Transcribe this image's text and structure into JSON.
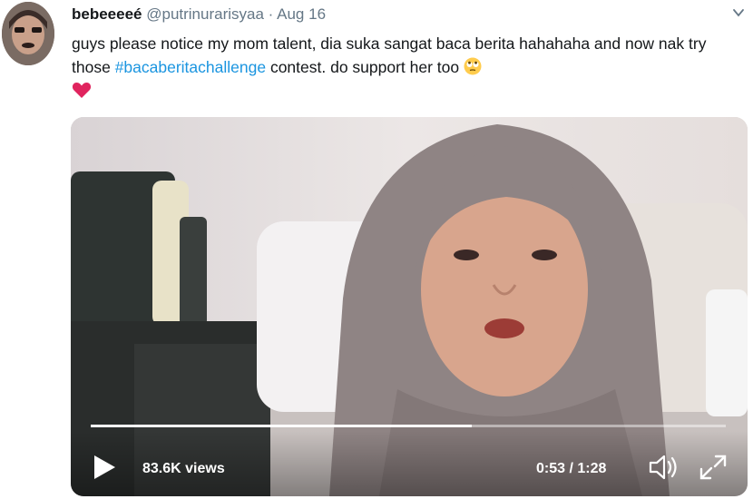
{
  "tweet": {
    "display_name": "bebeeeeé",
    "handle": "@putrinurarisyaa",
    "separator": "·",
    "date": "Aug 16",
    "text_before_hashtag": "guys please notice my mom talent, dia suka sangat baca berita hahahaha and now nak try those ",
    "hashtag": "#bacaberitachallenge",
    "text_after_hashtag": " contest. do support her too",
    "emojis": [
      "rolling-eyes-emoji",
      "red-heart-emoji"
    ]
  },
  "video": {
    "views": "83.6K views",
    "time": "0:53 / 1:28",
    "progress_fraction": 0.6
  },
  "icons": {
    "caret": "chevron-down-icon",
    "play": "play-icon",
    "volume": "volume-icon",
    "fullscreen": "fullscreen-icon"
  },
  "colors": {
    "hashtag": "#1b95e0",
    "handle": "#657786",
    "heart": "#e0245e"
  }
}
